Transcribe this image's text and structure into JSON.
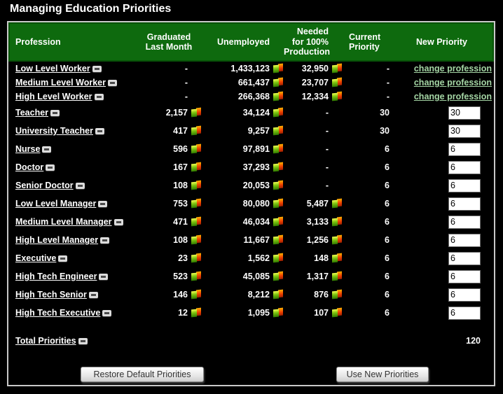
{
  "page_title": "Managing Education Priorities",
  "colors": {
    "header_green": "#0e6a0e",
    "link_green": "#a5d6a5"
  },
  "table": {
    "headers": {
      "profession": "Profession",
      "graduated": "Graduated Last Month",
      "unemployed": "Unemployed",
      "needed": "Needed for 100% Production",
      "current": "Current Priority",
      "new": "New Priority"
    },
    "rows": [
      {
        "profession": "Low Level Worker",
        "graduated": "-",
        "graduated_icon": false,
        "unemployed": "1,433,123",
        "unemployed_icon": true,
        "needed": "32,950",
        "needed_icon": true,
        "current": "-",
        "new_type": "link",
        "new_value": "change profession"
      },
      {
        "profession": "Medium Level Worker",
        "graduated": "-",
        "graduated_icon": false,
        "unemployed": "661,437",
        "unemployed_icon": true,
        "needed": "23,707",
        "needed_icon": true,
        "current": "-",
        "new_type": "link",
        "new_value": "change profession"
      },
      {
        "profession": "High Level Worker",
        "graduated": "-",
        "graduated_icon": false,
        "unemployed": "266,368",
        "unemployed_icon": true,
        "needed": "12,334",
        "needed_icon": true,
        "current": "-",
        "new_type": "link",
        "new_value": "change profession"
      },
      {
        "profession": "Teacher",
        "graduated": "2,157",
        "graduated_icon": true,
        "unemployed": "34,124",
        "unemployed_icon": true,
        "needed": "-",
        "needed_icon": false,
        "current": "30",
        "new_type": "input",
        "new_value": "30"
      },
      {
        "profession": "University Teacher",
        "graduated": "417",
        "graduated_icon": true,
        "unemployed": "9,257",
        "unemployed_icon": true,
        "needed": "-",
        "needed_icon": false,
        "current": "30",
        "new_type": "input",
        "new_value": "30"
      },
      {
        "profession": "Nurse",
        "graduated": "596",
        "graduated_icon": true,
        "unemployed": "97,891",
        "unemployed_icon": true,
        "needed": "-",
        "needed_icon": false,
        "current": "6",
        "new_type": "input",
        "new_value": "6"
      },
      {
        "profession": "Doctor",
        "graduated": "167",
        "graduated_icon": true,
        "unemployed": "37,293",
        "unemployed_icon": true,
        "needed": "-",
        "needed_icon": false,
        "current": "6",
        "new_type": "input",
        "new_value": "6"
      },
      {
        "profession": "Senior Doctor",
        "graduated": "108",
        "graduated_icon": true,
        "unemployed": "20,053",
        "unemployed_icon": true,
        "needed": "-",
        "needed_icon": false,
        "current": "6",
        "new_type": "input",
        "new_value": "6"
      },
      {
        "profession": "Low Level Manager",
        "graduated": "753",
        "graduated_icon": true,
        "unemployed": "80,080",
        "unemployed_icon": true,
        "needed": "5,487",
        "needed_icon": true,
        "current": "6",
        "new_type": "input",
        "new_value": "6"
      },
      {
        "profession": "Medium Level Manager",
        "graduated": "471",
        "graduated_icon": true,
        "unemployed": "46,034",
        "unemployed_icon": true,
        "needed": "3,133",
        "needed_icon": true,
        "current": "6",
        "new_type": "input",
        "new_value": "6"
      },
      {
        "profession": "High Level Manager",
        "graduated": "108",
        "graduated_icon": true,
        "unemployed": "11,667",
        "unemployed_icon": true,
        "needed": "1,256",
        "needed_icon": true,
        "current": "6",
        "new_type": "input",
        "new_value": "6"
      },
      {
        "profession": "Executive",
        "graduated": "23",
        "graduated_icon": true,
        "unemployed": "1,562",
        "unemployed_icon": true,
        "needed": "148",
        "needed_icon": true,
        "current": "6",
        "new_type": "input",
        "new_value": "6"
      },
      {
        "profession": "High Tech Engineer",
        "graduated": "523",
        "graduated_icon": true,
        "unemployed": "45,085",
        "unemployed_icon": true,
        "needed": "1,317",
        "needed_icon": true,
        "current": "6",
        "new_type": "input",
        "new_value": "6"
      },
      {
        "profession": "High Tech Senior",
        "graduated": "146",
        "graduated_icon": true,
        "unemployed": "8,212",
        "unemployed_icon": true,
        "needed": "876",
        "needed_icon": true,
        "current": "6",
        "new_type": "input",
        "new_value": "6"
      },
      {
        "profession": "High Tech Executive",
        "graduated": "12",
        "graduated_icon": true,
        "unemployed": "1,095",
        "unemployed_icon": true,
        "needed": "107",
        "needed_icon": true,
        "current": "6",
        "new_type": "input",
        "new_value": "6"
      }
    ],
    "total": {
      "label": "Total Priorities",
      "value": "120"
    }
  },
  "buttons": {
    "restore": "Restore Default Priorities",
    "use": "Use New Priorities"
  }
}
